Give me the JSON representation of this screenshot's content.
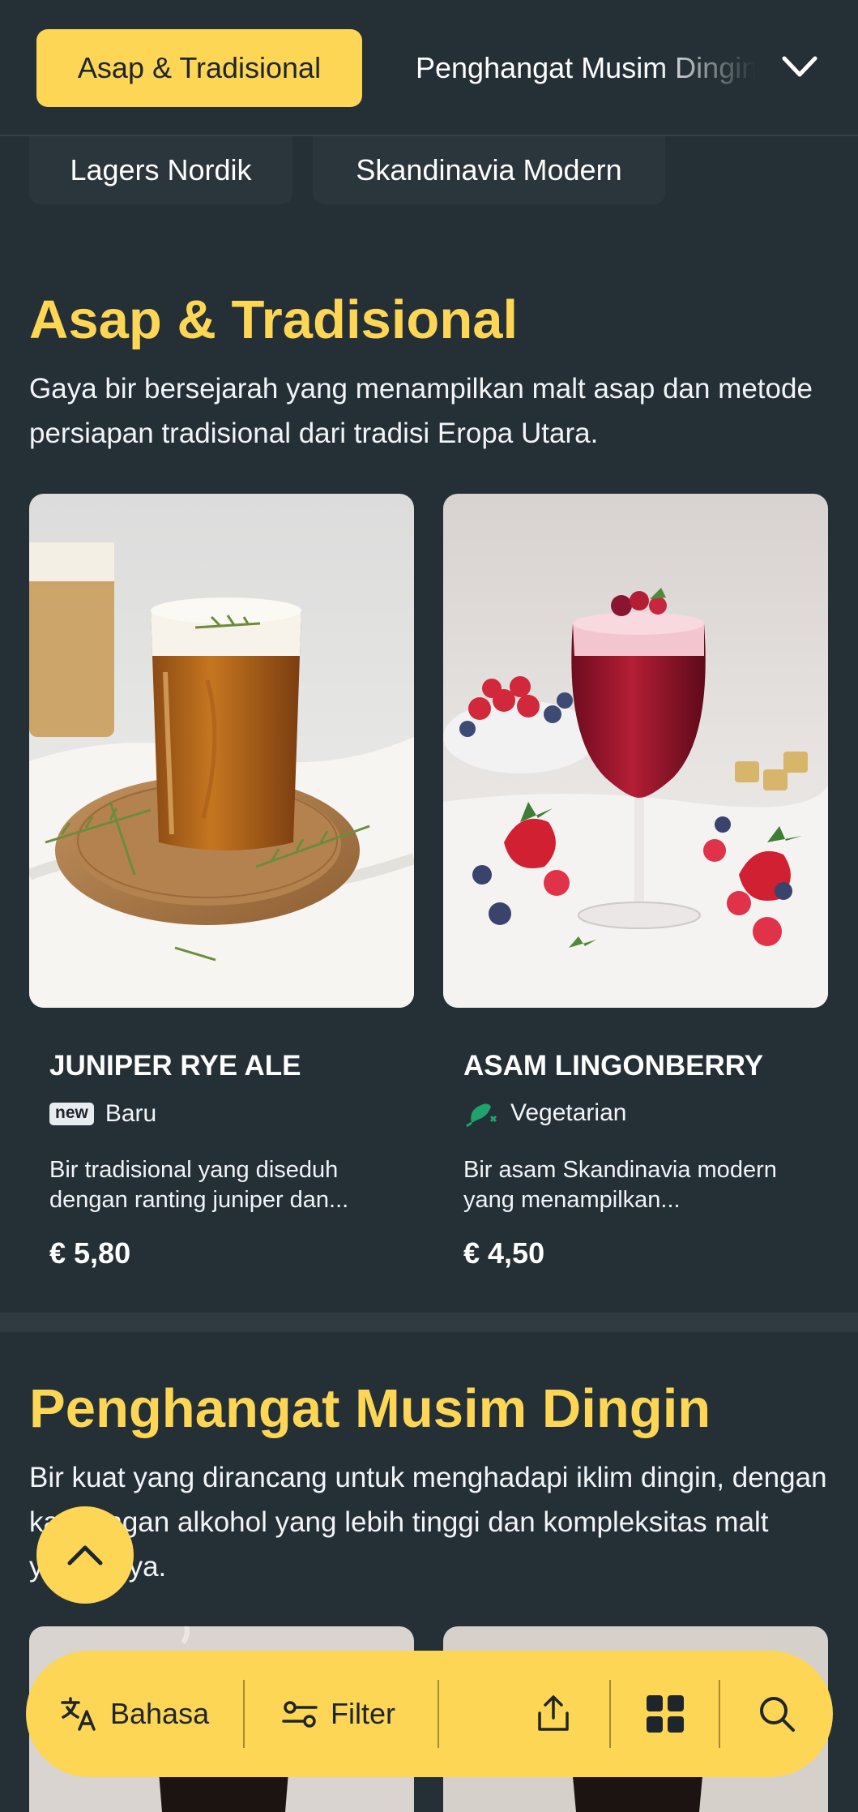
{
  "nav": {
    "active_category": "Asap & Tradisional",
    "next_category": "Penghangat Musim Dingin",
    "chips": [
      "Lagers Nordik",
      "Skandinavia Modern"
    ]
  },
  "sections": [
    {
      "title": "Asap & Tradisional",
      "description": "Gaya bir bersejarah yang menampilkan malt asap dan metode persiapan tradisional dari tradisi Eropa Utara.",
      "items": [
        {
          "name": "JUNIPER RYE ALE",
          "tag_badge": "new",
          "tag_label": "Baru",
          "description": "Bir tradisional yang diseduh dengan ranting juniper dan...",
          "price": "€ 5,80"
        },
        {
          "name": "ASAM LINGONBERRY",
          "tag_icon": "vegetarian-icon",
          "tag_label": "Vegetarian",
          "description": "Bir asam Skandinavia modern yang menampilkan...",
          "price": "€ 4,50"
        }
      ]
    },
    {
      "title": "Penghangat Musim Dingin",
      "description": "Bir kuat yang dirancang untuk menghadapi iklim dingin, dengan kandungan alkohol yang lebih tinggi dan kompleksitas malt yang kaya."
    }
  ],
  "bottom_bar": {
    "language_label": "Bahasa",
    "filter_label": "Filter"
  },
  "colors": {
    "background": "#242f36",
    "accent": "#fdd655",
    "vegetarian": "#1fa36b"
  }
}
